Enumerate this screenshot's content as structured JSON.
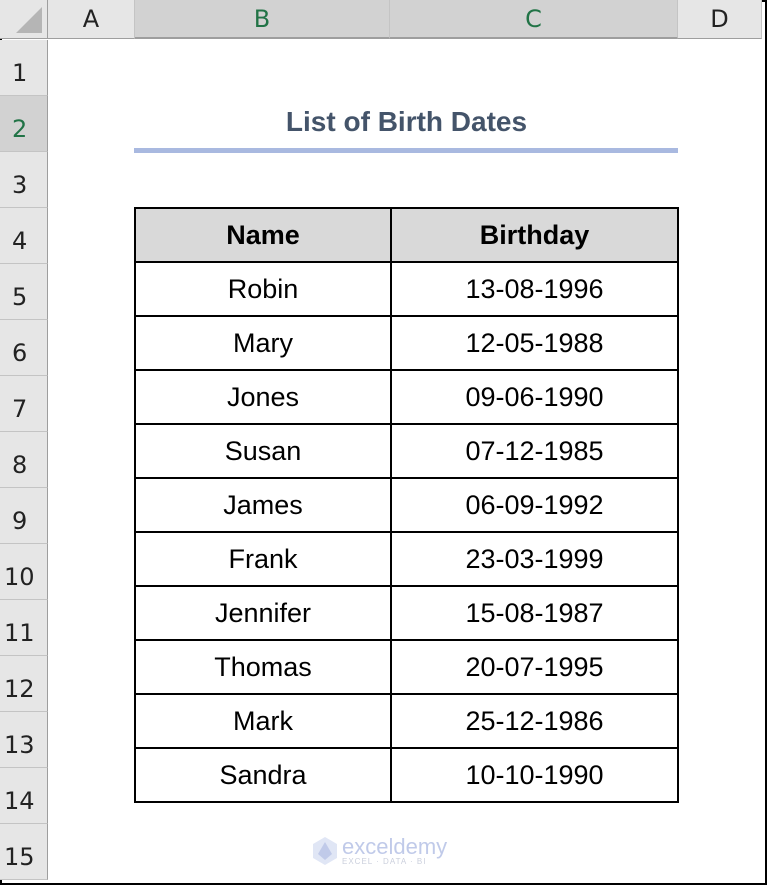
{
  "sheet": {
    "columns": [
      "A",
      "B",
      "C",
      "D"
    ],
    "selected_columns": [
      "B",
      "C"
    ],
    "rows": [
      "1",
      "2",
      "3",
      "4",
      "5",
      "6",
      "7",
      "8",
      "9",
      "10",
      "11",
      "12",
      "13",
      "14",
      "15"
    ],
    "selected_row": "2"
  },
  "title": "List of Birth Dates",
  "table": {
    "headers": [
      "Name",
      "Birthday"
    ],
    "rows": [
      [
        "Robin",
        "13-08-1996"
      ],
      [
        "Mary",
        "12-05-1988"
      ],
      [
        "Jones",
        "09-06-1990"
      ],
      [
        "Susan",
        "07-12-1985"
      ],
      [
        "James",
        "06-09-1992"
      ],
      [
        "Frank",
        "23-03-1999"
      ],
      [
        "Jennifer",
        "15-08-1987"
      ],
      [
        "Thomas",
        "20-07-1995"
      ],
      [
        "Mark",
        "25-12-1986"
      ],
      [
        "Sandra",
        "10-10-1990"
      ]
    ]
  },
  "watermark": {
    "name": "exceldemy",
    "tagline": "EXCEL · DATA · BI"
  },
  "colors": {
    "title": "#44546a",
    "title_underline": "#a9b9e0",
    "header_fill": "#d9d9d9",
    "selected_header_text": "#217346"
  }
}
